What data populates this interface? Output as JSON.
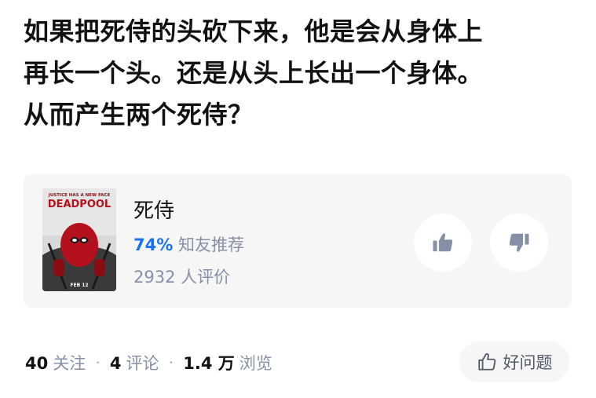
{
  "question": {
    "lines": [
      "如果把死侍的头砍下来，他是会从身体上",
      "再长一个头。还是从头上长出一个身体。",
      "从而产生两个死侍？"
    ]
  },
  "movie_card": {
    "poster": {
      "tagline": "JUSTICE HAS A NEW FACE",
      "logo": "DEADPOOL",
      "date": "FEB 12"
    },
    "title": "死侍",
    "recommend_percent": "74%",
    "recommend_label": "知友推荐",
    "review_count": "2932 人评价",
    "upvote_icon": "thumbs-up-icon",
    "downvote_icon": "thumbs-down-icon"
  },
  "footer": {
    "follow_count": "40",
    "follow_label": "关注",
    "comment_count": "4",
    "comment_label": "评论",
    "view_count": "1.4 万",
    "view_label": "浏览",
    "separator": "·",
    "good_question_label": "好问题",
    "good_question_icon": "thumbs-up-outline-icon"
  },
  "colors": {
    "accent_blue": "#1772f6",
    "muted_text": "#8590a6",
    "card_bg": "#f6f6f6"
  }
}
